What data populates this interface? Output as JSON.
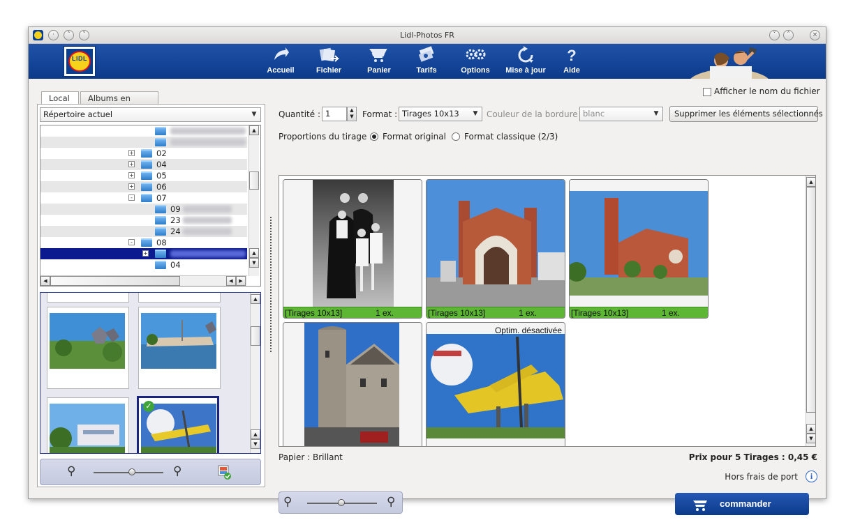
{
  "window": {
    "title": "Lidl-Photos FR"
  },
  "logo": {
    "text": "LIDL"
  },
  "toolbar": {
    "items": [
      {
        "label": "Accueil",
        "icon": "home-arrow-icon"
      },
      {
        "label": "Fichier",
        "icon": "file-import-icon"
      },
      {
        "label": "Panier",
        "icon": "cart-icon"
      },
      {
        "label": "Tarifs",
        "icon": "price-tag-icon"
      },
      {
        "label": "Options",
        "icon": "gears-icon"
      },
      {
        "label": "Mise à jour",
        "icon": "refresh-icon"
      },
      {
        "label": "Aide",
        "icon": "help-icon"
      }
    ]
  },
  "left": {
    "tabs": [
      "Local",
      "Albums en ligne"
    ],
    "active_tab": "Local",
    "directory_combo": "Répertoire actuel",
    "tree": [
      {
        "name": "02",
        "expander": "+"
      },
      {
        "name": "04",
        "expander": "+"
      },
      {
        "name": "05",
        "expander": "+"
      },
      {
        "name": "06",
        "expander": "+"
      },
      {
        "name": "07",
        "expander": "-"
      },
      {
        "name": "09",
        "expander": ""
      },
      {
        "name": "23",
        "expander": ""
      },
      {
        "name": "24",
        "expander": ""
      },
      {
        "name": "08",
        "expander": "-"
      },
      {
        "name": "",
        "expander": "+"
      },
      {
        "name": "04",
        "expander": ""
      }
    ],
    "zoom_level": 0.5
  },
  "right": {
    "quantity_label": "Quantité :",
    "quantity_value": "1",
    "format_label": "Format :",
    "format_value": "Tirages 10x13",
    "border_label": "Couleur de la bordure :",
    "border_value": "blanc",
    "delete_button": "Supprimer les éléments sélectionnés",
    "show_filename_label": "Afficher le nom du fichier",
    "show_filename_checked": false,
    "ratio_label": "Proportions du tirage :",
    "ratio_options": [
      "Format original",
      "Format classique (2/3)"
    ],
    "ratio_selected": "Format original",
    "photos": [
      {
        "format": "[Tirages 10x13]",
        "qty": "1 ex.",
        "scene": "family-portrait",
        "note": ""
      },
      {
        "format": "[Tirages 10x13]",
        "qty": "1 ex.",
        "scene": "church-front",
        "note": ""
      },
      {
        "format": "[Tirages 10x13]",
        "qty": "1 ex.",
        "scene": "church-side",
        "note": ""
      },
      {
        "format": "",
        "qty": "",
        "scene": "castle-tower",
        "note": ""
      },
      {
        "format": "",
        "qty": "",
        "scene": "airplane-sculpture",
        "note": "Optim. désactivée"
      }
    ],
    "paper_label": "Papier : Brillant",
    "price_label": "Prix pour 5 Tirages : 0,45 €",
    "shipping_label": "Hors frais de port",
    "order_button": "commander",
    "zoom_level": 0.5
  },
  "colors": {
    "brand_blue": "#0c3a8a",
    "brand_yellow": "#f7d21c",
    "brand_red": "#d8141b",
    "selection_green": "#5db634",
    "tree_selection": "#0b1a8e"
  }
}
